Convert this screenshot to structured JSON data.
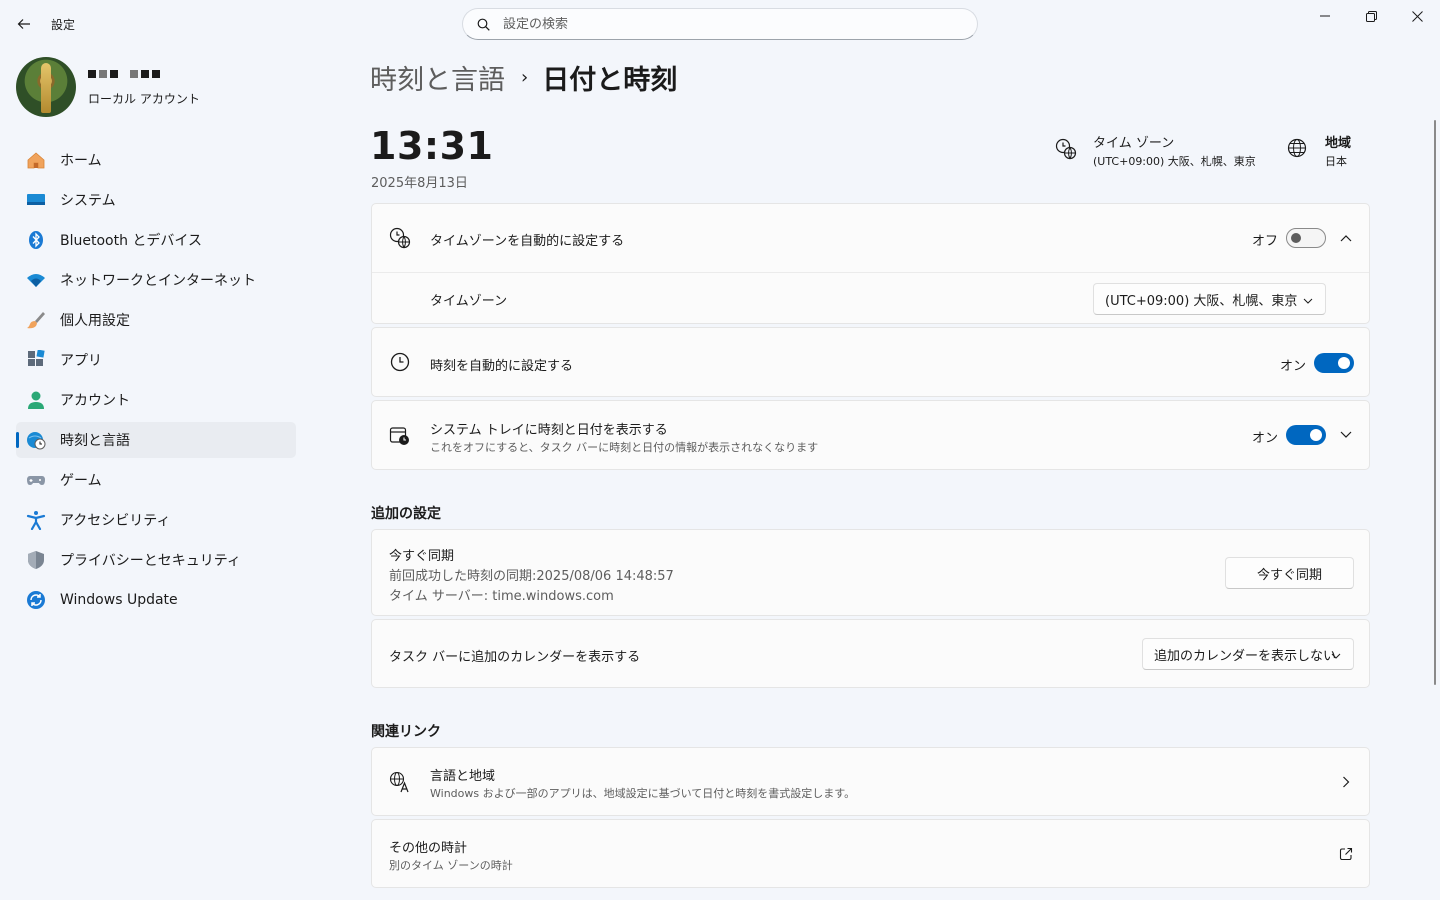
{
  "window": {
    "title": "設定",
    "search_placeholder": "設定の検索"
  },
  "profile": {
    "account_type": "ローカル アカウント"
  },
  "sidebar": {
    "items": [
      {
        "label": "ホーム",
        "icon": "home-icon"
      },
      {
        "label": "システム",
        "icon": "monitor-icon"
      },
      {
        "label": "Bluetooth とデバイス",
        "icon": "bluetooth-icon"
      },
      {
        "label": "ネットワークとインターネット",
        "icon": "wifi-icon"
      },
      {
        "label": "個人用設定",
        "icon": "paintbrush-icon"
      },
      {
        "label": "アプリ",
        "icon": "apps-icon"
      },
      {
        "label": "アカウント",
        "icon": "person-icon"
      },
      {
        "label": "時刻と言語",
        "icon": "globe-clock-icon",
        "active": true
      },
      {
        "label": "ゲーム",
        "icon": "gamepad-icon"
      },
      {
        "label": "アクセシビリティ",
        "icon": "accessibility-icon"
      },
      {
        "label": "プライバシーとセキュリティ",
        "icon": "shield-icon"
      },
      {
        "label": "Windows Update",
        "icon": "update-icon"
      }
    ]
  },
  "breadcrumb": {
    "parent": "時刻と言語",
    "separator": "›",
    "current": "日付と時刻"
  },
  "header": {
    "time": "13:31",
    "date": "2025年8月13日",
    "timezone_label": "タイム ゾーン",
    "timezone_value": "(UTC+09:00) 大阪、札幌、東京",
    "region_label": "地域",
    "region_value": "日本"
  },
  "settings": {
    "auto_timezone": {
      "title": "タイムゾーンを自動的に設定する",
      "state": "オフ"
    },
    "timezone": {
      "title": "タイムゾーン",
      "value": "(UTC+09:00) 大阪、札幌、東京"
    },
    "auto_time": {
      "title": "時刻を自動的に設定する",
      "state": "オン"
    },
    "tray": {
      "title": "システム トレイに時刻と日付を表示する",
      "subtitle": "これをオフにすると、タスク バーに時刻と日付の情報が表示されなくなります",
      "state": "オン"
    }
  },
  "additional": {
    "section_title": "追加の設定",
    "sync": {
      "title": "今すぐ同期",
      "last_sync": "前回成功した時刻の同期:2025/08/06 14:48:57",
      "server": "タイム サーバー: time.windows.com",
      "button": "今すぐ同期"
    },
    "calendar": {
      "title": "タスク バーに追加のカレンダーを表示する",
      "value": "追加のカレンダーを表示しない"
    }
  },
  "related": {
    "section_title": "関連リンク",
    "language_region": {
      "title": "言語と地域",
      "subtitle": "Windows および一部のアプリは、地域設定に基づいて日付と時刻を書式設定します。"
    },
    "other_clocks": {
      "title": "その他の時計",
      "subtitle": "別のタイム ゾーンの時計"
    }
  },
  "colors": {
    "accent": "#0067c0",
    "background": "#f3f6fb",
    "card": "#fbfbfb"
  }
}
